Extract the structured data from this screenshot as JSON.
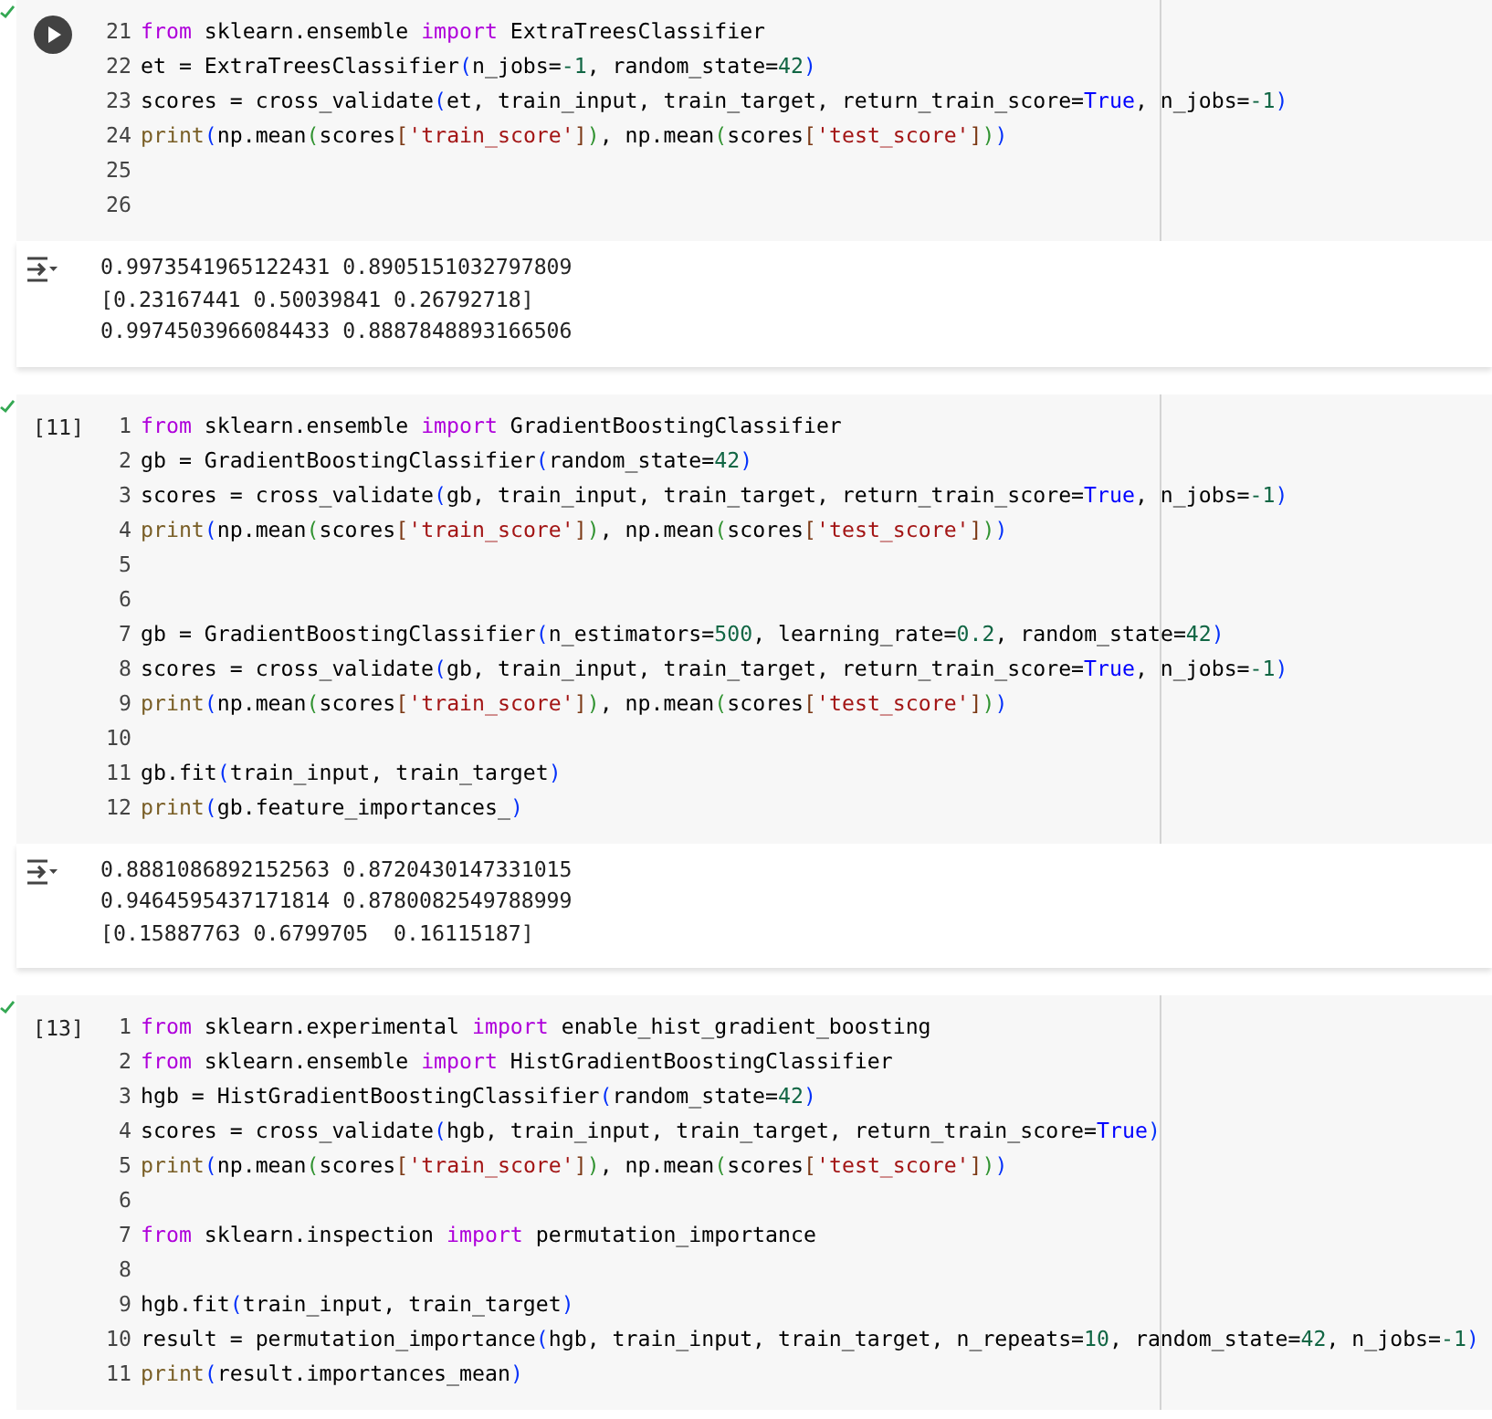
{
  "cells": [
    {
      "executed": true,
      "gutter": {
        "kind": "run-button"
      },
      "lines": [
        {
          "number": "21",
          "tokens": [
            {
              "kind": "keyword",
              "text": "from"
            },
            {
              "kind": "plain",
              "text": " sklearn.ensemble "
            },
            {
              "kind": "keyword",
              "text": "import"
            },
            {
              "kind": "plain",
              "text": " ExtraTreesClassifier"
            }
          ]
        },
        {
          "number": "22",
          "tokens": [
            {
              "kind": "plain",
              "text": "et = ExtraTreesClassifier"
            },
            {
              "kind": "paren",
              "text": "("
            },
            {
              "kind": "plain",
              "text": "n_jobs="
            },
            {
              "kind": "number",
              "text": "-1"
            },
            {
              "kind": "plain",
              "text": ", random_state="
            },
            {
              "kind": "number",
              "text": "42"
            },
            {
              "kind": "paren",
              "text": ")"
            }
          ]
        },
        {
          "number": "23",
          "tokens": [
            {
              "kind": "plain",
              "text": "scores = cross_validate"
            },
            {
              "kind": "paren",
              "text": "("
            },
            {
              "kind": "plain",
              "text": "et, train_input, train_target, return_train_score="
            },
            {
              "kind": "constant",
              "text": "True"
            },
            {
              "kind": "plain",
              "text": ", n_jobs="
            },
            {
              "kind": "number",
              "text": "-1"
            },
            {
              "kind": "paren",
              "text": ")"
            }
          ]
        },
        {
          "number": "24",
          "tokens": [
            {
              "kind": "function",
              "text": "print"
            },
            {
              "kind": "paren",
              "text": "("
            },
            {
              "kind": "plain",
              "text": "np.mean"
            },
            {
              "kind": "inner-paren",
              "text": "("
            },
            {
              "kind": "plain",
              "text": "scores"
            },
            {
              "kind": "bracket",
              "text": "["
            },
            {
              "kind": "string",
              "text": "'train_score'"
            },
            {
              "kind": "bracket",
              "text": "]"
            },
            {
              "kind": "inner-paren",
              "text": ")"
            },
            {
              "kind": "plain",
              "text": ", np.mean"
            },
            {
              "kind": "inner-paren",
              "text": "("
            },
            {
              "kind": "plain",
              "text": "scores"
            },
            {
              "kind": "bracket",
              "text": "["
            },
            {
              "kind": "string",
              "text": "'test_score'"
            },
            {
              "kind": "bracket",
              "text": "]"
            },
            {
              "kind": "inner-paren",
              "text": ")"
            },
            {
              "kind": "paren",
              "text": ")"
            }
          ]
        },
        {
          "number": "25"
        },
        {
          "number": "26"
        }
      ],
      "output": [
        "0.9973541965122431 0.8905151032797809",
        "[0.23167441 0.50039841 0.26792718]",
        "0.9974503966084433 0.8887848893166506"
      ]
    },
    {
      "executed": true,
      "gutter": {
        "kind": "count",
        "text": "[11]"
      },
      "lines": [
        {
          "number": "1",
          "tokens": [
            {
              "kind": "keyword",
              "text": "from"
            },
            {
              "kind": "plain",
              "text": " sklearn.ensemble "
            },
            {
              "kind": "keyword",
              "text": "import"
            },
            {
              "kind": "plain",
              "text": " GradientBoostingClassifier"
            }
          ]
        },
        {
          "number": "2",
          "tokens": [
            {
              "kind": "plain",
              "text": "gb = GradientBoostingClassifier"
            },
            {
              "kind": "paren",
              "text": "("
            },
            {
              "kind": "plain",
              "text": "random_state="
            },
            {
              "kind": "number",
              "text": "42"
            },
            {
              "kind": "paren",
              "text": ")"
            }
          ]
        },
        {
          "number": "3",
          "tokens": [
            {
              "kind": "plain",
              "text": "scores = cross_validate"
            },
            {
              "kind": "paren",
              "text": "("
            },
            {
              "kind": "plain",
              "text": "gb, train_input, train_target, return_train_score="
            },
            {
              "kind": "constant",
              "text": "True"
            },
            {
              "kind": "plain",
              "text": ", n_jobs="
            },
            {
              "kind": "number",
              "text": "-1"
            },
            {
              "kind": "paren",
              "text": ")"
            }
          ]
        },
        {
          "number": "4",
          "tokens": [
            {
              "kind": "function",
              "text": "print"
            },
            {
              "kind": "paren",
              "text": "("
            },
            {
              "kind": "plain",
              "text": "np.mean"
            },
            {
              "kind": "inner-paren",
              "text": "("
            },
            {
              "kind": "plain",
              "text": "scores"
            },
            {
              "kind": "bracket",
              "text": "["
            },
            {
              "kind": "string",
              "text": "'train_score'"
            },
            {
              "kind": "bracket",
              "text": "]"
            },
            {
              "kind": "inner-paren",
              "text": ")"
            },
            {
              "kind": "plain",
              "text": ", np.mean"
            },
            {
              "kind": "inner-paren",
              "text": "("
            },
            {
              "kind": "plain",
              "text": "scores"
            },
            {
              "kind": "bracket",
              "text": "["
            },
            {
              "kind": "string",
              "text": "'test_score'"
            },
            {
              "kind": "bracket",
              "text": "]"
            },
            {
              "kind": "inner-paren",
              "text": ")"
            },
            {
              "kind": "paren",
              "text": ")"
            }
          ]
        },
        {
          "number": "5"
        },
        {
          "number": "6"
        },
        {
          "number": "7",
          "tokens": [
            {
              "kind": "plain",
              "text": "gb = GradientBoostingClassifier"
            },
            {
              "kind": "paren",
              "text": "("
            },
            {
              "kind": "plain",
              "text": "n_estimators="
            },
            {
              "kind": "number",
              "text": "500"
            },
            {
              "kind": "plain",
              "text": ", learning_rate="
            },
            {
              "kind": "number",
              "text": "0.2"
            },
            {
              "kind": "plain",
              "text": ", random_state="
            },
            {
              "kind": "number",
              "text": "42"
            },
            {
              "kind": "paren",
              "text": ")"
            }
          ]
        },
        {
          "number": "8",
          "tokens": [
            {
              "kind": "plain",
              "text": "scores = cross_validate"
            },
            {
              "kind": "paren",
              "text": "("
            },
            {
              "kind": "plain",
              "text": "gb, train_input, train_target, return_train_score="
            },
            {
              "kind": "constant",
              "text": "True"
            },
            {
              "kind": "plain",
              "text": ", n_jobs="
            },
            {
              "kind": "number",
              "text": "-1"
            },
            {
              "kind": "paren",
              "text": ")"
            }
          ]
        },
        {
          "number": "9",
          "tokens": [
            {
              "kind": "function",
              "text": "print"
            },
            {
              "kind": "paren",
              "text": "("
            },
            {
              "kind": "plain",
              "text": "np.mean"
            },
            {
              "kind": "inner-paren",
              "text": "("
            },
            {
              "kind": "plain",
              "text": "scores"
            },
            {
              "kind": "bracket",
              "text": "["
            },
            {
              "kind": "string",
              "text": "'train_score'"
            },
            {
              "kind": "bracket",
              "text": "]"
            },
            {
              "kind": "inner-paren",
              "text": ")"
            },
            {
              "kind": "plain",
              "text": ", np.mean"
            },
            {
              "kind": "inner-paren",
              "text": "("
            },
            {
              "kind": "plain",
              "text": "scores"
            },
            {
              "kind": "bracket",
              "text": "["
            },
            {
              "kind": "string",
              "text": "'test_score'"
            },
            {
              "kind": "bracket",
              "text": "]"
            },
            {
              "kind": "inner-paren",
              "text": ")"
            },
            {
              "kind": "paren",
              "text": ")"
            }
          ]
        },
        {
          "number": "10"
        },
        {
          "number": "11",
          "tokens": [
            {
              "kind": "plain",
              "text": "gb.fit"
            },
            {
              "kind": "paren",
              "text": "("
            },
            {
              "kind": "plain",
              "text": "train_input, train_target"
            },
            {
              "kind": "paren",
              "text": ")"
            }
          ]
        },
        {
          "number": "12",
          "tokens": [
            {
              "kind": "function",
              "text": "print"
            },
            {
              "kind": "paren",
              "text": "("
            },
            {
              "kind": "plain",
              "text": "gb.feature_importances_"
            },
            {
              "kind": "paren",
              "text": ")"
            }
          ]
        }
      ],
      "output": [
        "0.8881086892152563 0.8720430147331015",
        "0.9464595437171814 0.8780082549788999",
        "[0.15887763 0.6799705  0.16115187]"
      ]
    },
    {
      "executed": true,
      "gutter": {
        "kind": "count",
        "text": "[13]"
      },
      "lines": [
        {
          "number": "1",
          "tokens": [
            {
              "kind": "keyword",
              "text": "from"
            },
            {
              "kind": "plain",
              "text": " sklearn.experimental "
            },
            {
              "kind": "keyword",
              "text": "import"
            },
            {
              "kind": "plain",
              "text": " enable_hist_gradient_boosting"
            }
          ]
        },
        {
          "number": "2",
          "tokens": [
            {
              "kind": "keyword",
              "text": "from"
            },
            {
              "kind": "plain",
              "text": " sklearn.ensemble "
            },
            {
              "kind": "keyword",
              "text": "import"
            },
            {
              "kind": "plain",
              "text": " HistGradientBoostingClassifier"
            }
          ]
        },
        {
          "number": "3",
          "tokens": [
            {
              "kind": "plain",
              "text": "hgb = HistGradientBoostingClassifier"
            },
            {
              "kind": "paren",
              "text": "("
            },
            {
              "kind": "plain",
              "text": "random_state="
            },
            {
              "kind": "number",
              "text": "42"
            },
            {
              "kind": "paren",
              "text": ")"
            }
          ]
        },
        {
          "number": "4",
          "tokens": [
            {
              "kind": "plain",
              "text": "scores = cross_validate"
            },
            {
              "kind": "paren",
              "text": "("
            },
            {
              "kind": "plain",
              "text": "hgb, train_input, train_target, return_train_score="
            },
            {
              "kind": "constant",
              "text": "True"
            },
            {
              "kind": "paren",
              "text": ")"
            }
          ]
        },
        {
          "number": "5",
          "tokens": [
            {
              "kind": "function",
              "text": "print"
            },
            {
              "kind": "paren",
              "text": "("
            },
            {
              "kind": "plain",
              "text": "np.mean"
            },
            {
              "kind": "inner-paren",
              "text": "("
            },
            {
              "kind": "plain",
              "text": "scores"
            },
            {
              "kind": "bracket",
              "text": "["
            },
            {
              "kind": "string",
              "text": "'train_score'"
            },
            {
              "kind": "bracket",
              "text": "]"
            },
            {
              "kind": "inner-paren",
              "text": ")"
            },
            {
              "kind": "plain",
              "text": ", np.mean"
            },
            {
              "kind": "inner-paren",
              "text": "("
            },
            {
              "kind": "plain",
              "text": "scores"
            },
            {
              "kind": "bracket",
              "text": "["
            },
            {
              "kind": "string",
              "text": "'test_score'"
            },
            {
              "kind": "bracket",
              "text": "]"
            },
            {
              "kind": "inner-paren",
              "text": ")"
            },
            {
              "kind": "paren",
              "text": ")"
            }
          ]
        },
        {
          "number": "6"
        },
        {
          "number": "7",
          "tokens": [
            {
              "kind": "keyword",
              "text": "from"
            },
            {
              "kind": "plain",
              "text": " sklearn.inspection "
            },
            {
              "kind": "keyword",
              "text": "import"
            },
            {
              "kind": "plain",
              "text": " permutation_importance"
            }
          ]
        },
        {
          "number": "8"
        },
        {
          "number": "9",
          "tokens": [
            {
              "kind": "plain",
              "text": "hgb.fit"
            },
            {
              "kind": "paren",
              "text": "("
            },
            {
              "kind": "plain",
              "text": "train_input, train_target"
            },
            {
              "kind": "paren",
              "text": ")"
            }
          ]
        },
        {
          "number": "10",
          "tokens": [
            {
              "kind": "plain",
              "text": "result = permutation_importance"
            },
            {
              "kind": "paren",
              "text": "("
            },
            {
              "kind": "plain",
              "text": "hgb, train_input, train_target, n_repeats="
            },
            {
              "kind": "number",
              "text": "10"
            },
            {
              "kind": "plain",
              "text": ", random_state="
            },
            {
              "kind": "number",
              "text": "42"
            },
            {
              "kind": "plain",
              "text": ", n_jobs="
            },
            {
              "kind": "number",
              "text": "-1"
            },
            {
              "kind": "paren",
              "text": ")"
            }
          ]
        },
        {
          "number": "11",
          "tokens": [
            {
              "kind": "function",
              "text": "print"
            },
            {
              "kind": "paren",
              "text": "("
            },
            {
              "kind": "plain",
              "text": "result.importances_mean"
            },
            {
              "kind": "paren",
              "text": ")"
            }
          ]
        }
      ]
    }
  ]
}
